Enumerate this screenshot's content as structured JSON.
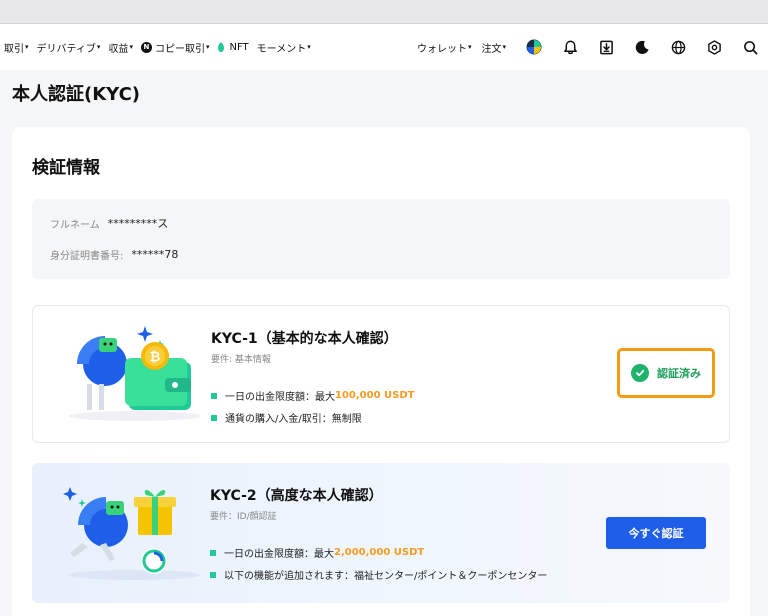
{
  "nav": {
    "left_items": [
      {
        "label": "取引",
        "caret": "▾"
      },
      {
        "label": "デリバティブ",
        "caret": "▾"
      },
      {
        "label": "収益",
        "caret": "▾"
      },
      {
        "label": "コピー取引",
        "caret": "▾",
        "badge": "N"
      },
      {
        "label": "NFT",
        "caret": ""
      },
      {
        "label": "モーメント",
        "caret": "▾"
      }
    ],
    "wallet": "ウォレット",
    "orders": "注文",
    "caret": "▾"
  },
  "page_title": "本人認証(KYC)",
  "section_title": "検証情報",
  "info": {
    "fullname_label": "フルネーム",
    "fullname_value": "*********ス",
    "id_label": "身分証明書番号:",
    "id_value": "******78"
  },
  "kyc1": {
    "title": "KYC-1（基本的な本人確認）",
    "requirement": "要件: 基本情報",
    "limit_prefix": "一日の出金限度額：最大",
    "limit_value": "100,000 USDT",
    "item2": "通貨の購入/入金/取引：無制限",
    "status": "認証済み"
  },
  "kyc2": {
    "title": "KYC-2（高度な本人確認）",
    "requirement": "要件：ID/顔認証",
    "limit_prefix": "一日の出金限度額：最大",
    "limit_value": "2,000,000 USDT",
    "item2": "以下の機能が追加されます：福祉センター/ポイント＆クーポンセンター",
    "button": "今すぐ認証"
  },
  "colors": {
    "accent_blue": "#1f5ee8",
    "success_green": "#20b26b",
    "highlight_orange": "#f59a23",
    "focus_border": "#f39c12"
  }
}
